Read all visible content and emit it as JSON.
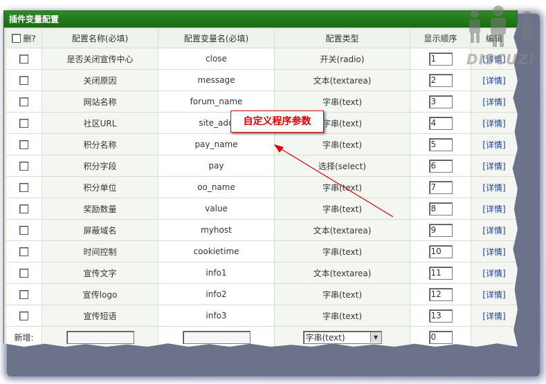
{
  "panel": {
    "title": "插件变量配置"
  },
  "header": {
    "delete_label": "删?",
    "name_col": "配置名称(必填)",
    "var_col": "配置变量名(必填)",
    "type_col": "配置类型",
    "order_col": "显示顺序",
    "edit_col": "编辑"
  },
  "rows": [
    {
      "name": "是否关闭宣传中心",
      "var": "close",
      "type": "开关(radio)",
      "order": "1",
      "edit": "[详情]"
    },
    {
      "name": "关闭原因",
      "var": "message",
      "type": "文本(textarea)",
      "order": "2",
      "edit": "[详情]"
    },
    {
      "name": "网站名称",
      "var": "forum_name",
      "type": "字串(text)",
      "order": "3",
      "edit": "[详情]"
    },
    {
      "name": "社区URL",
      "var": "site_add",
      "type": "字串(text)",
      "order": "4",
      "edit": "[详情]"
    },
    {
      "name": "积分名称",
      "var": "pay_name",
      "type": "字串(text)",
      "order": "5",
      "edit": "[详情]"
    },
    {
      "name": "积分字段",
      "var": "pay",
      "type": "选择(select)",
      "order": "6",
      "edit": "[详情]"
    },
    {
      "name": "积分单位",
      "var": "oo_name",
      "type": "字串(text)",
      "order": "7",
      "edit": "[详情]"
    },
    {
      "name": "奖励数量",
      "var": "value",
      "type": "字串(text)",
      "order": "8",
      "edit": "[详情]"
    },
    {
      "name": "屏蔽域名",
      "var": "myhost",
      "type": "文本(textarea)",
      "order": "9",
      "edit": "[详情]"
    },
    {
      "name": "时间控制",
      "var": "cookietime",
      "type": "字串(text)",
      "order": "10",
      "edit": "[详情]"
    },
    {
      "name": "宣传文字",
      "var": "info1",
      "type": "文本(textarea)",
      "order": "11",
      "edit": "[详情]"
    },
    {
      "name": "宣传logo",
      "var": "info2",
      "type": "字串(text)",
      "order": "12",
      "edit": "[详情]"
    },
    {
      "name": "宣传短语",
      "var": "info3",
      "type": "字串(text)",
      "order": "13",
      "edit": "[详情]"
    }
  ],
  "new_row": {
    "label": "新增:",
    "type_value": "字串(text)",
    "order_value": "0"
  },
  "annotation": {
    "text": "自定义程序参数"
  },
  "logo": {
    "text": "DISCUZ!"
  },
  "colors": {
    "title_bar": "#1f7318",
    "annotation": "#d00000"
  }
}
